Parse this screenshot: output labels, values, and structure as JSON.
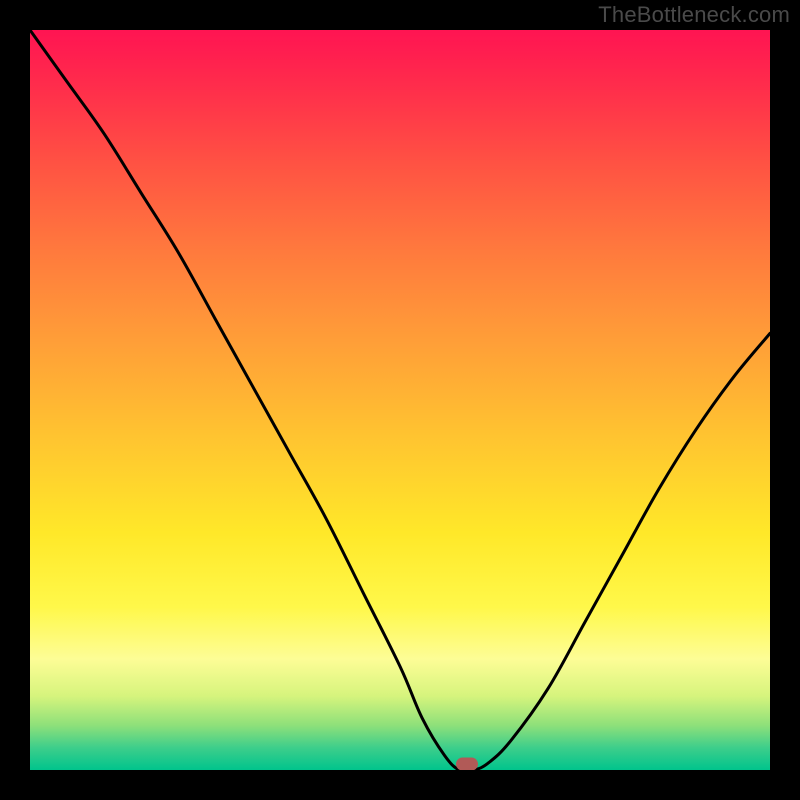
{
  "watermark": "TheBottleneck.com",
  "chart_data": {
    "type": "line",
    "title": "",
    "xlabel": "",
    "ylabel": "",
    "xlim": [
      0,
      100
    ],
    "ylim": [
      0,
      100
    ],
    "x": [
      0,
      5,
      10,
      15,
      20,
      25,
      30,
      35,
      40,
      45,
      50,
      53,
      56,
      58,
      60,
      62,
      65,
      70,
      75,
      80,
      85,
      90,
      95,
      100
    ],
    "values": [
      100,
      93,
      86,
      78,
      70,
      61,
      52,
      43,
      34,
      24,
      14,
      7,
      2,
      0,
      0,
      1,
      4,
      11,
      20,
      29,
      38,
      46,
      53,
      59
    ],
    "marker": {
      "x": 59,
      "y": 0
    },
    "gradient_stops": [
      {
        "pos": 0,
        "color": "#ff1452"
      },
      {
        "pos": 18,
        "color": "#ff5243"
      },
      {
        "pos": 42,
        "color": "#ff9e38"
      },
      {
        "pos": 68,
        "color": "#ffe829"
      },
      {
        "pos": 85,
        "color": "#fdfd96"
      },
      {
        "pos": 97,
        "color": "#3dce8b"
      },
      {
        "pos": 100,
        "color": "#00c48c"
      }
    ]
  }
}
